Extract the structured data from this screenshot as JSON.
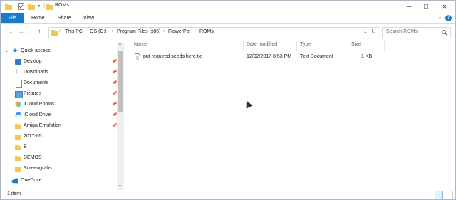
{
  "window": {
    "title": "ROMs",
    "minimize": "─",
    "maximize": "☐",
    "close": "✕"
  },
  "ribbon": {
    "tabs": [
      "File",
      "Home",
      "Share",
      "View"
    ],
    "help_icon": "help-icon"
  },
  "address": {
    "breadcrumbs": [
      "This PC",
      "OS (C:)",
      "Program Files (x86)",
      "FlowerPot",
      "ROMs"
    ],
    "search_placeholder": "Search ROMs"
  },
  "nav": {
    "items": [
      {
        "label": "Quick access",
        "icon": "star-icon",
        "pinned": false
      },
      {
        "label": "Desktop",
        "icon": "desktop-icon",
        "pinned": true
      },
      {
        "label": "Downloads",
        "icon": "download-icon",
        "pinned": true
      },
      {
        "label": "Documents",
        "icon": "document-icon",
        "pinned": true
      },
      {
        "label": "Pictures",
        "icon": "pictures-icon",
        "pinned": true
      },
      {
        "label": "iCloud Photos",
        "icon": "icloud-photos-icon",
        "pinned": true
      },
      {
        "label": "iCloud Drive",
        "icon": "icloud-drive-icon",
        "pinned": true
      },
      {
        "label": "Amiga Emulation",
        "icon": "folder-icon",
        "pinned": true
      },
      {
        "label": "2017-05",
        "icon": "folder-icon",
        "pinned": false
      },
      {
        "label": "B",
        "icon": "folder-icon",
        "pinned": false
      },
      {
        "label": "DEMOS",
        "icon": "folder-icon",
        "pinned": false
      },
      {
        "label": "Screengrabs",
        "icon": "folder-icon",
        "pinned": false
      },
      {
        "label": "OneDrive",
        "icon": "cloud-icon",
        "pinned": false
      }
    ]
  },
  "columns": [
    "Name",
    "Date modified",
    "Type",
    "Size"
  ],
  "files": [
    {
      "name": "put required seeds here.txt",
      "date": "12/02/2017 8:53 PM",
      "type": "Text Document",
      "size": "1 KB"
    }
  ],
  "status": {
    "count": "1 item"
  },
  "colors": {
    "accent": "#1979ca",
    "folder": "#f2c94c"
  }
}
